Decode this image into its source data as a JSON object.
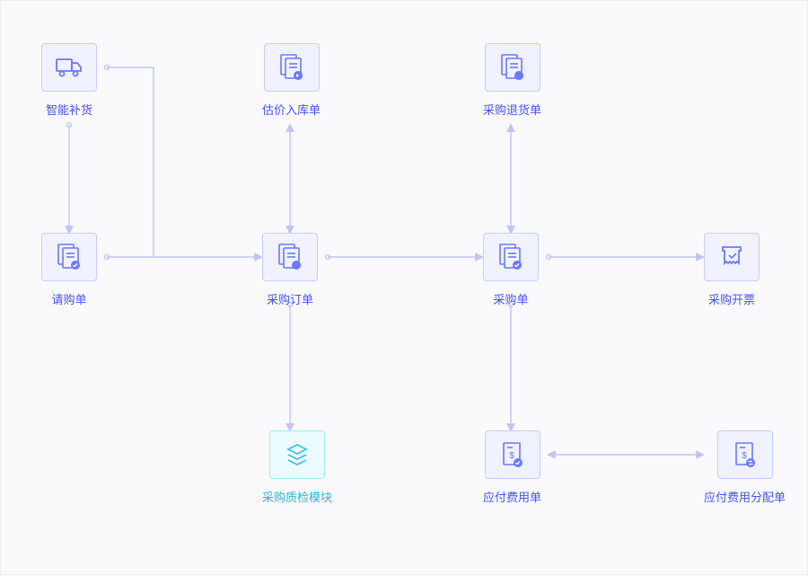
{
  "colors": {
    "node_bg": "#f0f2ff",
    "node_border": "#c8ccff",
    "node_alt_bg": "#ecfbff",
    "node_alt_border": "#a7e7f5",
    "accent": "#5c6bff",
    "accent_alt": "#29b6d6",
    "arrow": "#bfc4ff"
  },
  "nodes": {
    "smart_replenish": {
      "label": "智能补货",
      "icon": "truck"
    },
    "purchase_request": {
      "label": "请购单",
      "icon": "doc-check"
    },
    "valuation_inbound": {
      "label": "估价入库单",
      "icon": "doc-arrow"
    },
    "purchase_order": {
      "label": "采购订单",
      "icon": "doc-order"
    },
    "purchase_return": {
      "label": "采购退货单",
      "icon": "doc-return"
    },
    "purchase_doc": {
      "label": "采购单",
      "icon": "doc-check"
    },
    "purchase_invoice": {
      "label": "采购开票",
      "icon": "invoice"
    },
    "qc_module": {
      "label": "采购质检模块",
      "icon": "stack",
      "alt": true
    },
    "payable_expense": {
      "label": "应付费用单",
      "icon": "doc-money-check"
    },
    "payable_expense_alloc": {
      "label": "应付费用分配单",
      "icon": "doc-money-swap"
    }
  },
  "edges": [
    {
      "from": "smart_replenish",
      "to": "purchase_request",
      "dir": "down"
    },
    {
      "from": "purchase_request",
      "to": "purchase_order",
      "dir": "right"
    },
    {
      "from": "smart_replenish",
      "to": "purchase_order",
      "dir": "right-down"
    },
    {
      "from": "purchase_order",
      "to": "valuation_inbound",
      "dir": "both-vertical"
    },
    {
      "from": "purchase_order",
      "to": "purchase_doc",
      "dir": "right"
    },
    {
      "from": "purchase_order",
      "to": "qc_module",
      "dir": "down"
    },
    {
      "from": "purchase_doc",
      "to": "purchase_return",
      "dir": "both-vertical"
    },
    {
      "from": "purchase_doc",
      "to": "purchase_invoice",
      "dir": "right"
    },
    {
      "from": "purchase_doc",
      "to": "payable_expense",
      "dir": "down"
    },
    {
      "from": "payable_expense",
      "to": "payable_expense_alloc",
      "dir": "both-horizontal"
    }
  ]
}
